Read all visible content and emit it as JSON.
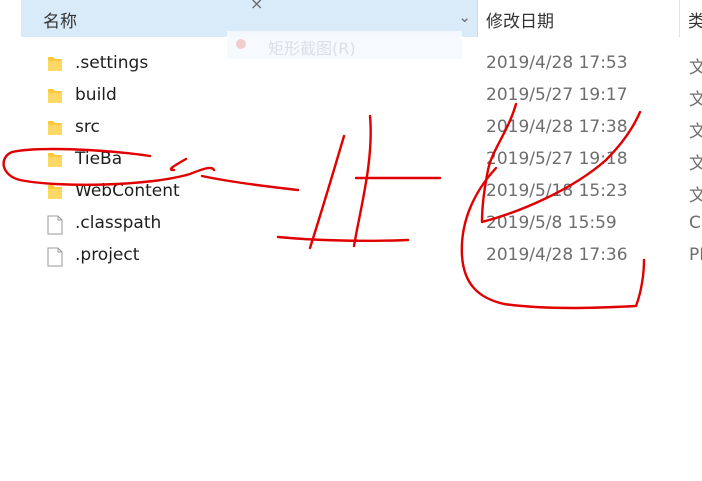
{
  "header": {
    "name_label": "名称",
    "date_label": "修改日期",
    "type_label": "类"
  },
  "ghost_menu": {
    "label": "矩形截图(R)"
  },
  "files": [
    {
      "name": ".settings",
      "date": "2019/4/28 17:53",
      "type": "文",
      "icon": "folder-icon"
    },
    {
      "name": "build",
      "date": "2019/5/27 19:17",
      "type": "文",
      "icon": "folder-icon"
    },
    {
      "name": "src",
      "date": "2019/4/28 17:38",
      "type": "文",
      "icon": "folder-icon"
    },
    {
      "name": "TieBa",
      "date": "2019/5/27 19:18",
      "type": "文",
      "icon": "folder-icon"
    },
    {
      "name": "WebContent",
      "date": "2019/5/18 15:23",
      "type": "文",
      "icon": "folder-icon"
    },
    {
      "name": ".classpath",
      "date": "2019/5/8 15:59",
      "type": "C",
      "icon": "file-icon"
    },
    {
      "name": ".project",
      "date": "2019/4/28 17:36",
      "type": "PI",
      "icon": "file-icon"
    }
  ],
  "colors": {
    "header_bg": "#d9ebf9",
    "ink": "#e00000",
    "folder": "#ffc83d"
  }
}
